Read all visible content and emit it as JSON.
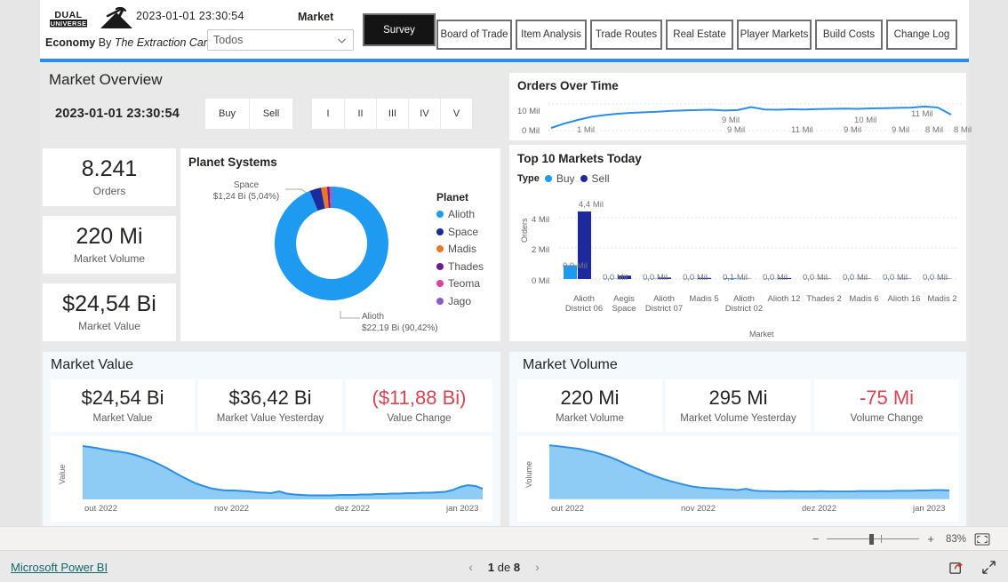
{
  "header": {
    "logo_text_top": "DUAL",
    "logo_text_bottom": "UNIVERSE",
    "datetime": "2023-01-01 23:30:54",
    "section_label": "Market",
    "economy_prefix": "Economy",
    "economy_by": "By",
    "economy_author": "The Extraction Cartel",
    "slicer_value": "Todos",
    "survey_button": "Survey",
    "nav_buttons": [
      "Board of Trade",
      "Item Analysis",
      "Trade Routes",
      "Real Estate",
      "Player Markets",
      "Build Costs",
      "Change Log"
    ]
  },
  "market_overview": {
    "title": "Market Overview",
    "timestamp": "2023-01-01 23:30:54",
    "type_toggles": [
      "Buy",
      "Sell"
    ],
    "tier_toggles": [
      "I",
      "II",
      "III",
      "IV",
      "V"
    ],
    "kpis": [
      {
        "value": "8.241",
        "label": "Orders"
      },
      {
        "value": "220 Mi",
        "label": "Market Volume"
      },
      {
        "value": "$24,54 Bi",
        "label": "Market Value"
      }
    ]
  },
  "planet_systems": {
    "title": "Planet Systems",
    "legend_title": "Planet",
    "callout_space": {
      "name": "Space",
      "value": "$1,24 Bi (5,04%)"
    },
    "callout_alioth": {
      "name": "Alioth",
      "value": "$22,19 Bi (90,42%)"
    },
    "chart_data": {
      "type": "pie",
      "title": "Planet Systems",
      "categories": [
        "Alioth",
        "Space",
        "Madis",
        "Thades",
        "Teoma",
        "Jago"
      ],
      "values": [
        22.19,
        1.24,
        0.7,
        0.3,
        0.2,
        0.11
      ],
      "value_unit": "Bi USD",
      "percents": [
        90.42,
        5.04,
        2.2,
        1.0,
        0.8,
        0.54
      ],
      "colors": [
        "#1e9bf0",
        "#1d2a9e",
        "#ee7723",
        "#6c1c8c",
        "#e040a0",
        "#8a5ad6"
      ],
      "labels": [
        "$22,19 Bi (90,42%)",
        "$1,24 Bi (5,04%)"
      ],
      "legend_position": "right",
      "donut": true
    }
  },
  "orders_over_time": {
    "title": "Orders Over Time",
    "chart_data": {
      "type": "line",
      "title": "Orders Over Time",
      "xlabel": "",
      "ylabel": "",
      "ylim": [
        0,
        10
      ],
      "ytick_labels": [
        "0 Mil",
        "10 Mil"
      ],
      "yticks": [
        0,
        10
      ],
      "grid": true,
      "line_color": "#2b8fe3",
      "data_labels": [
        "1 Mil",
        "9 Mil",
        "9 Mil",
        "11 Mil",
        "9 Mil",
        "10 Mil",
        "9 Mil",
        "11 Mil",
        "8 Mil",
        "8 Mil"
      ],
      "values": [
        1.0,
        3.6,
        5.4,
        6.6,
        7.1,
        7.6,
        8.0,
        8.3,
        8.6,
        9.0,
        9.2,
        9.4,
        9.6,
        9.3,
        9.5,
        10.6,
        9.7,
        9.6,
        9.8,
        9.7,
        9.9,
        10.0,
        10.1,
        10.0,
        10.2,
        10.3,
        10.4,
        10.5,
        10.9,
        10.6,
        8.2
      ]
    }
  },
  "top_markets": {
    "title": "Top 10 Markets Today",
    "legend_label": "Type",
    "chart_data": {
      "type": "bar",
      "title": "Top 10 Markets Today",
      "xlabel": "Market",
      "ylabel": "Orders",
      "ylim": [
        0,
        5
      ],
      "ytick_labels": [
        "0 Mil",
        "2 Mil",
        "4 Mil"
      ],
      "yticks": [
        0,
        2,
        4
      ],
      "grid": true,
      "categories": [
        "Alioth District 06",
        "Aegis Space",
        "Alioth District 07",
        "Madis 5",
        "Alioth District 02",
        "Alioth 12",
        "Thades 2",
        "Madis 6",
        "Alioth 16",
        "Madis 2"
      ],
      "series": [
        {
          "name": "Buy",
          "color": "#1e9bf0",
          "values": [
            0.9,
            0.02,
            0.02,
            0.02,
            0.05,
            0.02,
            0.01,
            0.01,
            0.01,
            0.01
          ]
        },
        {
          "name": "Sell",
          "color": "#1d2a9e",
          "values": [
            4.4,
            0.22,
            0.09,
            0.07,
            0.03,
            0.06,
            0.03,
            0.03,
            0.03,
            0.03
          ]
        }
      ],
      "total_labels": [
        "4,4 Mil",
        "0,0 Mil",
        "0,0 Mil",
        "0,0 Mil",
        "0,1 Mil",
        "0,0 Mil",
        "0,0 Mil",
        "0,0 Mil",
        "0,0 Mil",
        "0,0 Mil"
      ],
      "buy_label": "0,9 Mil"
    }
  },
  "market_value": {
    "title": "Market Value",
    "kpis": [
      {
        "value": "$24,54 Bi",
        "label": "Market Value",
        "negative": false
      },
      {
        "value": "$36,42 Bi",
        "label": "Market Value Yesterday",
        "negative": false
      },
      {
        "value": "($11,88 Bi)",
        "label": "Value Change",
        "negative": true
      }
    ],
    "chart_data": {
      "type": "area",
      "title": "Market Value",
      "ylabel": "Value",
      "xlabel": "",
      "xtick_labels": [
        "out 2022",
        "nov 2022",
        "dez 2022",
        "jan 2023"
      ],
      "line_color": "#2b8fe3",
      "fill_color": "#8ecbf5",
      "values": [
        100,
        99,
        97,
        95,
        93,
        92,
        90,
        87,
        83,
        79,
        74,
        68,
        62,
        56,
        50,
        45,
        41,
        38,
        36,
        35,
        35,
        34,
        33,
        32,
        31,
        30,
        33,
        29,
        27,
        26,
        25,
        25,
        25,
        25,
        26,
        26,
        26,
        27,
        27,
        28,
        28,
        29,
        29,
        30,
        30,
        31,
        31,
        32,
        33,
        36,
        41,
        44,
        43,
        38
      ]
    }
  },
  "market_volume": {
    "title": "Market Volume",
    "kpis": [
      {
        "value": "220 Mi",
        "label": "Market Volume",
        "negative": false
      },
      {
        "value": "295 Mi",
        "label": "Market Volume Yesterday",
        "negative": false
      },
      {
        "value": "-75 Mi",
        "label": "Volume Change",
        "negative": true
      }
    ],
    "chart_data": {
      "type": "area",
      "title": "Market Volume",
      "ylabel": "Volume",
      "xlabel": "",
      "xtick_labels": [
        "out 2022",
        "nov 2022",
        "dez 2022",
        "jan 2023"
      ],
      "line_color": "#2b8fe3",
      "fill_color": "#8ecbf5",
      "values": [
        100,
        99,
        97,
        95,
        93,
        90,
        87,
        83,
        78,
        73,
        67,
        61,
        55,
        49,
        44,
        39,
        34,
        30,
        26,
        23,
        21,
        20,
        19,
        18,
        17,
        16,
        18,
        15,
        14,
        14,
        13,
        13,
        14,
        13,
        13,
        13,
        14,
        13,
        13,
        13,
        13,
        14,
        14,
        14,
        14,
        14,
        15,
        15,
        15,
        16,
        16,
        17,
        17,
        16
      ]
    }
  },
  "statusbar": {
    "zoom_minus": "−",
    "zoom_plus": "+",
    "zoom_level": "83%",
    "fit_icon": "fit-to-page-icon"
  },
  "footer": {
    "brand": "Microsoft Power BI",
    "prev_icon": "chevron-left-icon",
    "next_icon": "chevron-right-icon",
    "page_current": "1",
    "page_of": " de ",
    "page_total": "8",
    "share_icon": "share-icon",
    "fullscreen_icon": "fullscreen-icon"
  }
}
